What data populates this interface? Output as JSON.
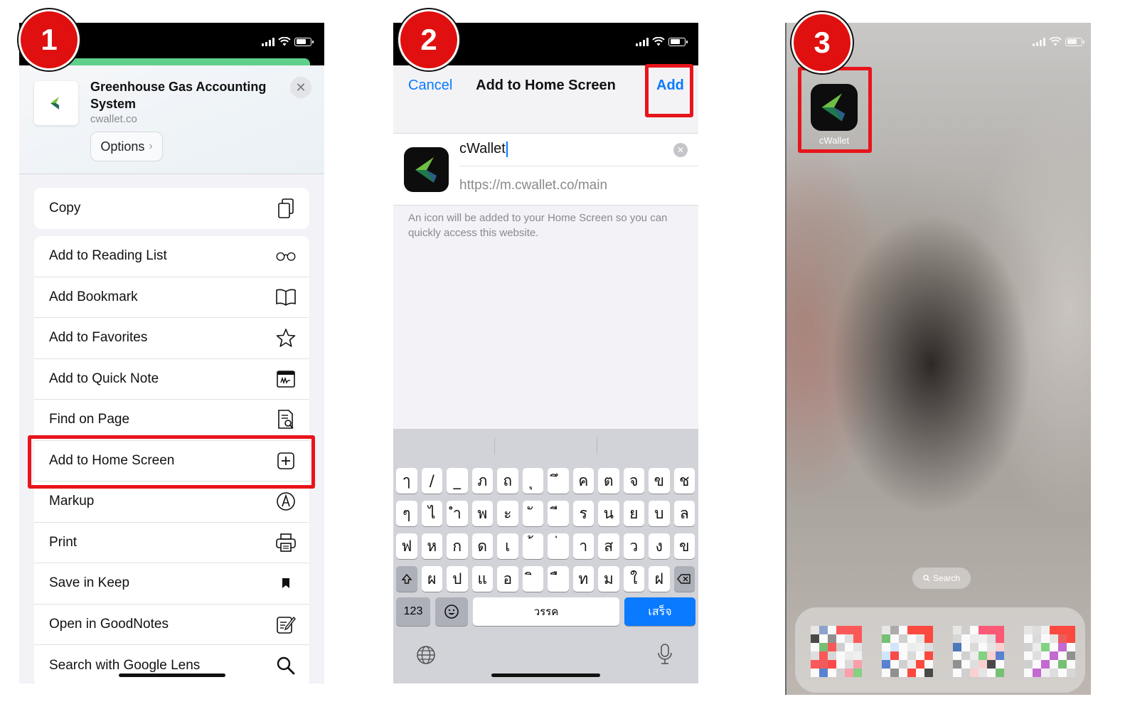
{
  "steps": [
    "1",
    "2",
    "3"
  ],
  "panel1": {
    "site_title": "Greenhouse Gas Accounting System",
    "site_url": "cwallet.co",
    "options_label": "Options",
    "close_glyph": "✕",
    "menu_groups": [
      [
        {
          "label": "Copy",
          "icon": "copy-icon"
        }
      ],
      [
        {
          "label": "Add to Reading List",
          "icon": "glasses-icon"
        },
        {
          "label": "Add Bookmark",
          "icon": "book-icon"
        },
        {
          "label": "Add to Favorites",
          "icon": "star-icon"
        },
        {
          "label": "Add to Quick Note",
          "icon": "quick-note-icon"
        },
        {
          "label": "Find on Page",
          "icon": "find-on-page-icon"
        },
        {
          "label": "Add to Home Screen",
          "icon": "plus-square-icon"
        },
        {
          "label": "Markup",
          "icon": "markup-icon"
        },
        {
          "label": "Print",
          "icon": "printer-icon"
        },
        {
          "label": "Save in Keep",
          "icon": "bookmark-icon"
        },
        {
          "label": "Open in GoodNotes",
          "icon": "goodnotes-icon"
        },
        {
          "label": "Search with Google Lens",
          "icon": "search-icon"
        }
      ]
    ],
    "highlighted_item": "Add to Home Screen"
  },
  "panel2": {
    "cancel_label": "Cancel",
    "title": "Add to Home Screen",
    "add_label": "Add",
    "name_value": "cWallet",
    "url_value": "https://m.cwallet.co/main",
    "hint": "An icon will be added to your Home Screen so you can quickly access this website.",
    "keyboard": {
      "row1": [
        "ๅ",
        "/",
        "_",
        "ภ",
        "ถ",
        "ุ",
        "ึ",
        "ค",
        "ต",
        "จ",
        "ข",
        "ช"
      ],
      "row2": [
        "ๆ",
        "ไ",
        "ำ",
        "พ",
        "ะ",
        "ั",
        "ี",
        "ร",
        "น",
        "ย",
        "บ",
        "ล"
      ],
      "row3": [
        "ฟ",
        "ห",
        "ก",
        "ด",
        "เ",
        "้",
        "่",
        "า",
        "ส",
        "ว",
        "ง",
        "ข"
      ],
      "row4": [
        "ผ",
        "ป",
        "แ",
        "อ",
        "ิ",
        "ื",
        "ท",
        "ม",
        "ใ",
        "ฝ"
      ],
      "num_label": "123",
      "space_label": "วรรค",
      "done_label": "เสร็จ"
    }
  },
  "panel3": {
    "app_label": "cWallet",
    "search_label": "Search"
  },
  "colors": {
    "badge_red": "#e01010",
    "highlight_red": "#e8141b",
    "ios_blue": "#0a7aff",
    "logo_green": "#4caf50"
  }
}
